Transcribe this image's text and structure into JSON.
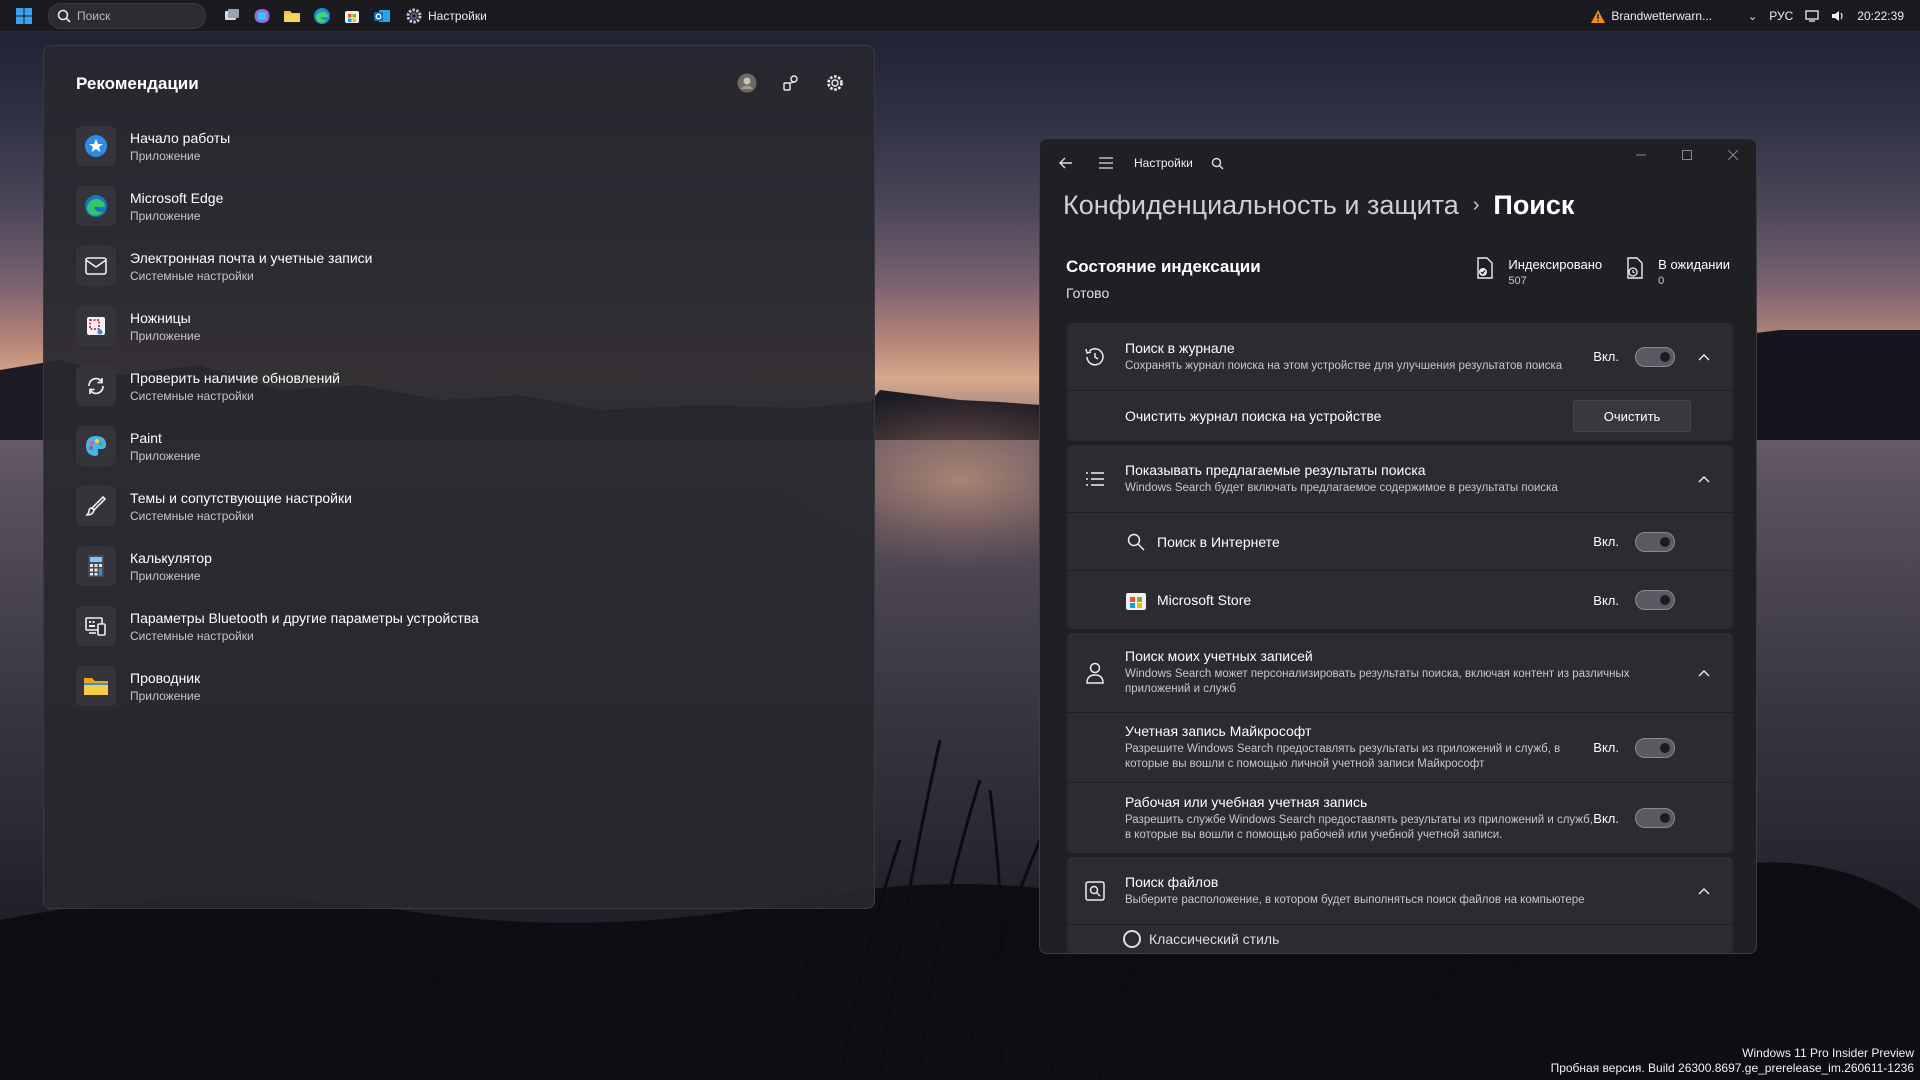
{
  "taskbar": {
    "search_placeholder": "Поиск",
    "settings_app_label": "Настройки",
    "tray": {
      "warning_text": "Brandwetterwarn...",
      "language": "РУС",
      "time": "20:22:39"
    }
  },
  "flyout": {
    "title": "Рекомендации",
    "items": [
      {
        "name": "Начало работы",
        "sub": "Приложение",
        "icon": "get-started-icon"
      },
      {
        "name": "Microsoft Edge",
        "sub": "Приложение",
        "icon": "edge-icon"
      },
      {
        "name": "Электронная почта и учетные записи",
        "sub": "Системные настройки",
        "icon": "mail-icon"
      },
      {
        "name": "Ножницы",
        "sub": "Приложение",
        "icon": "snipping-tool-icon"
      },
      {
        "name": "Проверить наличие обновлений",
        "sub": "Системные настройки",
        "icon": "sync-icon"
      },
      {
        "name": "Paint",
        "sub": "Приложение",
        "icon": "paint-icon"
      },
      {
        "name": "Темы и сопутствующие настройки",
        "sub": "Системные настройки",
        "icon": "brush-icon"
      },
      {
        "name": "Калькулятор",
        "sub": "Приложение",
        "icon": "calculator-icon"
      },
      {
        "name": "Параметры Bluetooth и другие параметры устройства",
        "sub": "Системные настройки",
        "icon": "devices-icon"
      },
      {
        "name": "Проводник",
        "sub": "Приложение",
        "icon": "folder-icon"
      }
    ]
  },
  "settings": {
    "window_title": "Настройки",
    "breadcrumb": {
      "parent": "Конфиденциальность и защита",
      "separator": "›",
      "current": "Поиск"
    },
    "indexing": {
      "title": "Состояние индексации",
      "state": "Готово",
      "indexed_label": "Индексировано",
      "indexed_value": "507",
      "pending_label": "В ожидании",
      "pending_value": "0"
    },
    "on_label": "Вкл.",
    "history": {
      "title": "Поиск в журнале",
      "desc": "Сохранять журнал поиска на этом устройстве для улучшения результатов поиска",
      "clear_label": "Очистить журнал поиска на устройстве",
      "clear_button": "Очистить"
    },
    "suggested": {
      "title": "Показывать предлагаемые результаты поиска",
      "desc": "Windows Search будет включать предлагаемое содержимое в результаты поиска",
      "web": "Поиск в Интернете",
      "store": "Microsoft Store"
    },
    "accounts": {
      "title": "Поиск моих учетных записей",
      "desc": "Windows Search может персонализировать результаты поиска, включая контент из различных приложений и служб",
      "msa_title": "Учетная запись Майкрософт",
      "msa_desc": "Разрешите Windows Search предоставлять результаты из приложений и служб, в которые вы вошли с помощью личной учетной записи Майкрософт",
      "work_title": "Рабочая или учебная учетная запись",
      "work_desc": "Разрешить службе Windows Search предоставлять результаты из приложений и служб, в которые вы вошли с помощью рабочей или учебной учетной записи."
    },
    "files": {
      "title": "Поиск файлов",
      "desc": "Выберите расположение, в котором будет выполняться поиск файлов на компьютере",
      "partial_option": "Классический стиль"
    }
  },
  "watermark": {
    "line1": "Windows 11 Pro Insider Preview",
    "line2": "Пробная версия. Build 26300.8697.ge_prerelease_im.260611-1236"
  },
  "colors": {
    "accent": "#0f6cbd",
    "window_bg": "#202024",
    "card_bg": "#2b2b30"
  }
}
